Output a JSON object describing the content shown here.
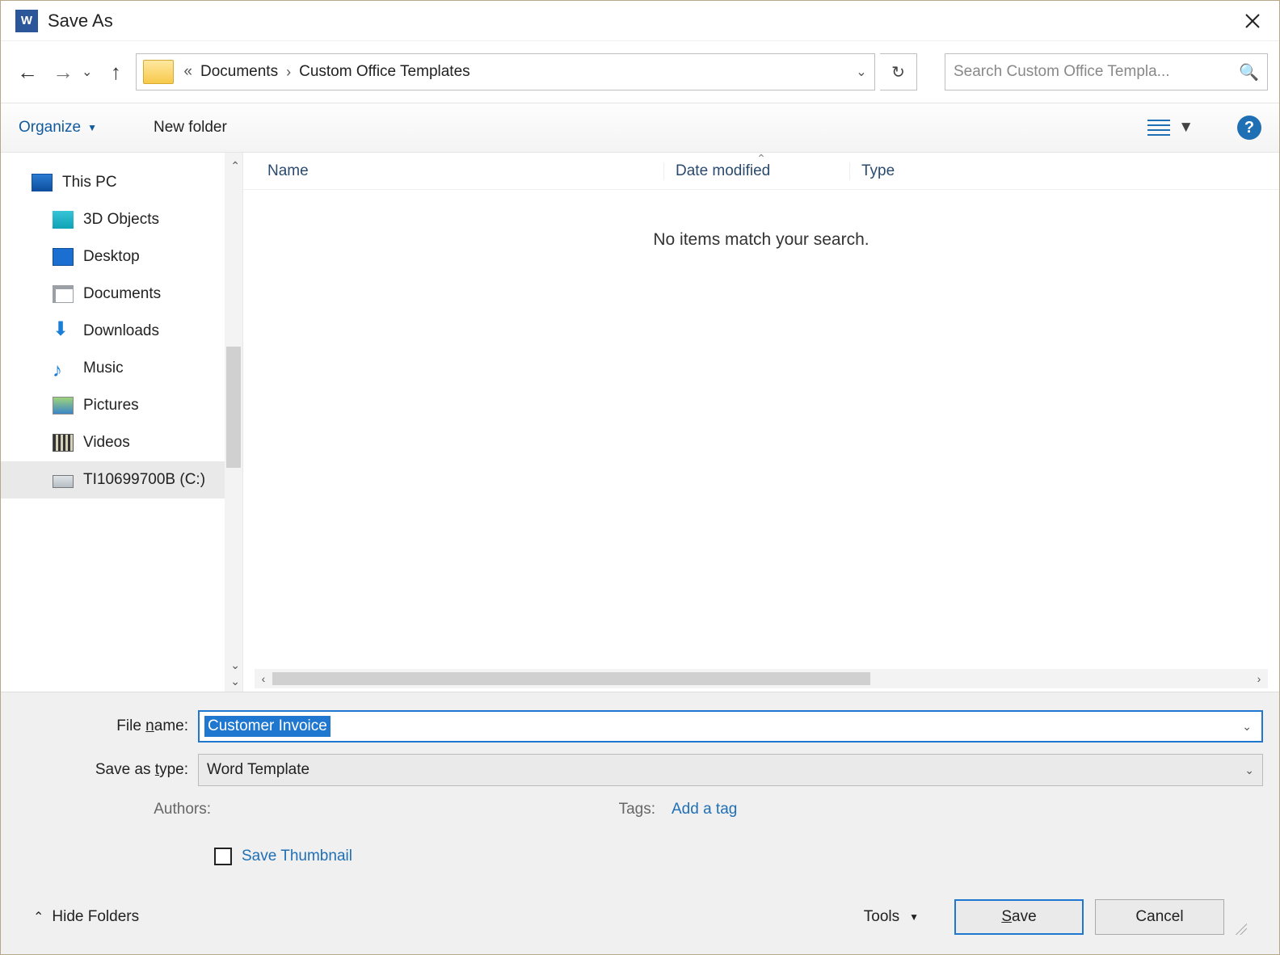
{
  "title": "Save As",
  "breadcrumbs": {
    "part1": "Documents",
    "part2": "Custom Office Templates"
  },
  "search": {
    "placeholder": "Search Custom Office Templa..."
  },
  "toolbar": {
    "organize": "Organize",
    "newfolder": "New folder"
  },
  "tree": {
    "root": "This PC",
    "items": [
      "3D Objects",
      "Desktop",
      "Documents",
      "Downloads",
      "Music",
      "Pictures",
      "Videos",
      "TI10699700B (C:)"
    ]
  },
  "columns": {
    "name": "Name",
    "date": "Date modified",
    "type": "Type"
  },
  "empty": "No items match your search.",
  "form": {
    "filename_label_pre": "File ",
    "filename_label_u": "n",
    "filename_label_post": "ame:",
    "filename_value": "Customer Invoice",
    "type_label_pre": "Save as ",
    "type_label_u": "t",
    "type_label_post": "ype:",
    "type_value": "Word Template",
    "authors_label": "Authors:",
    "tags_label": "Tags:",
    "tags_value": "Add a tag",
    "thumb_label": "Save Thumbnail"
  },
  "footer": {
    "hide": "Hide Folders",
    "tools": "Tools",
    "save_pre": "",
    "save_u": "S",
    "save_post": "ave",
    "cancel": "Cancel"
  }
}
